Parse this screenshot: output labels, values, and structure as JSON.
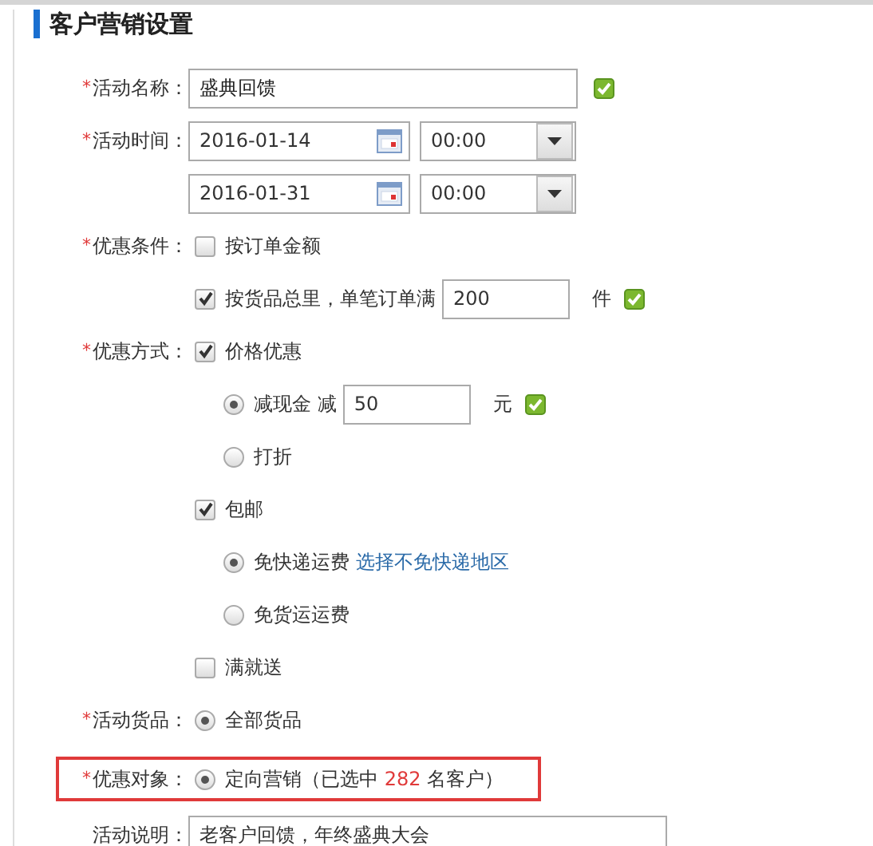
{
  "title": "客户营销设置",
  "fields": [
    {
      "kind": "text",
      "required_mark": "*",
      "label": "活动名称：",
      "value": "盛典回馈",
      "valid": true
    },
    {
      "kind": "datetime",
      "required_mark": "*",
      "label": "活动时间：",
      "ranges": [
        {
          "date": "2016-01-14",
          "time": "00:00"
        },
        {
          "date": "2016-01-31",
          "time": "00:00"
        }
      ]
    },
    {
      "kind": "options",
      "required_mark": "*",
      "label": "优惠条件：",
      "options": [
        {
          "kind": "checkbox",
          "checked": false,
          "label": "按订单金额"
        },
        {
          "kind": "checkbox",
          "checked": true,
          "label": "按货品总里，单笔订单满",
          "input": "200",
          "unit": "件",
          "valid": true
        }
      ]
    },
    {
      "kind": "options",
      "required_mark": "*",
      "label": "优惠方式：",
      "options": [
        {
          "kind": "checkbox",
          "checked": true,
          "label": "价格优惠",
          "children": [
            {
              "kind": "radio",
              "selected": true,
              "label": "减现金 减",
              "input": "50",
              "unit": "元",
              "valid": true
            },
            {
              "kind": "radio",
              "selected": false,
              "label": "打折"
            }
          ]
        },
        {
          "kind": "checkbox",
          "checked": true,
          "label": "包邮",
          "children": [
            {
              "kind": "radio",
              "selected": true,
              "label": "免快递运费",
              "link": "选择不免快递地区"
            },
            {
              "kind": "radio",
              "selected": false,
              "label": "免货运运费"
            }
          ]
        },
        {
          "kind": "checkbox",
          "checked": false,
          "label": "满就送"
        }
      ]
    },
    {
      "kind": "options",
      "required_mark": "*",
      "label": "活动货品：",
      "options": [
        {
          "kind": "radio",
          "selected": true,
          "label": "全部货品"
        }
      ]
    },
    {
      "kind": "options",
      "required_mark": "*",
      "label": "优惠对象：",
      "highlighted": true,
      "options": [
        {
          "kind": "radio",
          "selected": true,
          "label": "定向营销（已选中 ",
          "count": "282",
          "label_after": " 名客户）"
        }
      ]
    },
    {
      "kind": "textarea",
      "label": "活动说明：",
      "value": "老客户回馈，年终盛典大会"
    }
  ]
}
